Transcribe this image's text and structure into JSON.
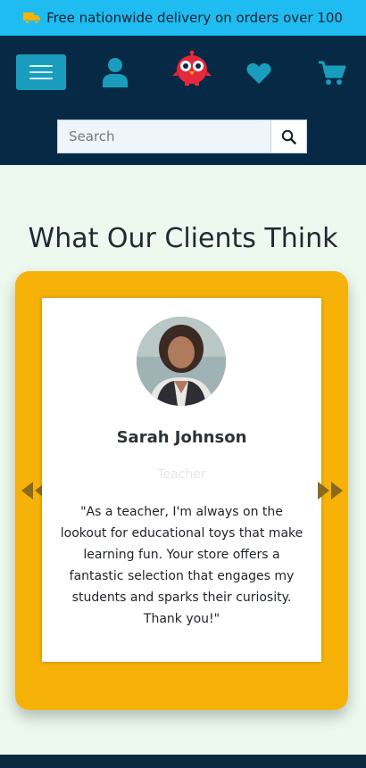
{
  "promo": {
    "text": "Free nationwide delivery on orders over 100",
    "icon": "truck-icon"
  },
  "nav": {
    "menu_icon": "hamburger-icon",
    "account_icon": "user-icon",
    "logo_icon": "owl-logo-icon",
    "wishlist_icon": "heart-icon",
    "cart_icon": "cart-icon"
  },
  "search": {
    "placeholder": "Search",
    "value": "",
    "button_icon": "search-icon"
  },
  "testimonials": {
    "title": "What Our Clients Think",
    "current": {
      "name": "Sarah Johnson",
      "role": "Teacher",
      "quote": "\"As a teacher, I'm always on the lookout for educational toys that make learning fun. Your store offers a fantastic selection that engages my students and sparks their curiosity. Thank you!\""
    },
    "prev_icon": "double-chevron-left-icon",
    "next_icon": "double-chevron-right-icon"
  },
  "colors": {
    "promo_bg": "#1ebcf0",
    "nav_bg": "#062a45",
    "accent": "#1a9dbd",
    "logo_red": "#e5283b",
    "carousel_bg": "#f6b209",
    "page_bg": "#edf9ee"
  }
}
